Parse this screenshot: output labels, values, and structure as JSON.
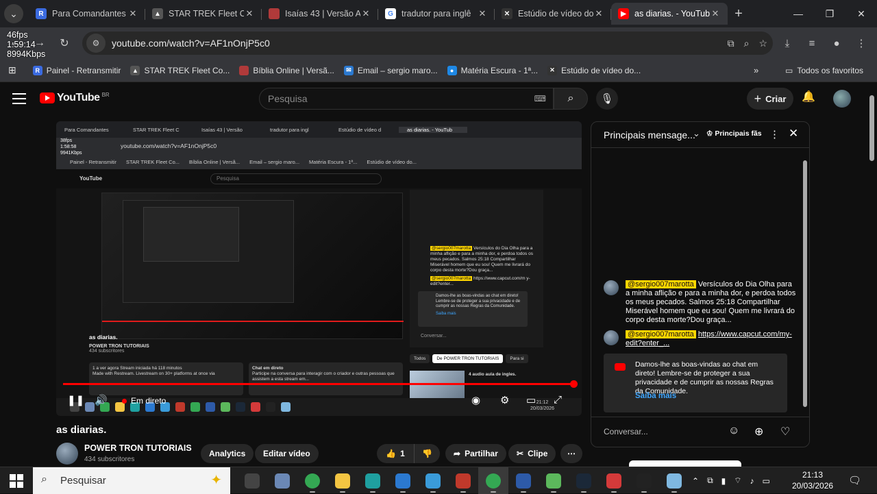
{
  "browser": {
    "tabs": [
      {
        "title": "Para Comandantes",
        "color": "#3b6be0",
        "glyph": "R"
      },
      {
        "title": "STAR TREK Fleet Co",
        "color": "#555555",
        "glyph": "▲"
      },
      {
        "title": "Isaías 43 | Versão A",
        "color": "#b03a3a",
        "glyph": ""
      },
      {
        "title": "tradutor para inglê",
        "color": "#ffffff",
        "glyph": "G"
      },
      {
        "title": "Estúdio de vídeo do",
        "color": "#333333",
        "glyph": "✕"
      },
      {
        "title": "as diarias. - YouTub",
        "color": "#ff0000",
        "glyph": "▶"
      }
    ],
    "url": "youtube.com/watch?v=AF1nOnjP5c0",
    "stats": [
      "46fps",
      "1:59:14",
      "8994Kbps"
    ],
    "bookmarks": [
      {
        "label": "Painel - Retransmitir",
        "color": "#3b6be0",
        "glyph": "R"
      },
      {
        "label": "STAR TREK Fleet Co...",
        "color": "#555555",
        "glyph": "▲"
      },
      {
        "label": "Bíblia Online | Versã...",
        "color": "#b03a3a",
        "glyph": ""
      },
      {
        "label": "Email – sergio maro...",
        "color": "#2b79d0",
        "glyph": "✉"
      },
      {
        "label": "Matéria Escura - 1ª...",
        "color": "#1e88e5",
        "glyph": "●"
      },
      {
        "label": "Estúdio de vídeo do...",
        "color": "#333333",
        "glyph": "✕"
      }
    ],
    "all_favorites": "Todos os favoritos"
  },
  "youtube": {
    "logo": "YouTube",
    "country": "BR",
    "search_placeholder": "Pesquisa",
    "create_label": "Criar",
    "video_title": "as diarias.",
    "channel_name": "POWER TRON TUTORIAIS",
    "subscribers": "434 subscritores",
    "analytics_label": "Analytics",
    "edit_label": "Editar vídeo",
    "likes": "1",
    "share_label": "Partilhar",
    "clip_label": "Clipe",
    "live_label": "Em direto"
  },
  "inner": {
    "tabs": [
      "Para Comandantes",
      "STAR TREK Fleet C",
      "Isaías 43 | Versão",
      "tradutor para ingl",
      "Estúdio de vídeo d",
      "as diarias. - YouTub"
    ],
    "stats": [
      "38fps",
      "1:58:58",
      "9941Kbps"
    ],
    "url": "youtube.com/watch?v=AF1nOnjP5c0",
    "bookmarks": [
      "Painel - Retransmitir",
      "STAR TREK Fleet Co...",
      "Bíblia Online | Versã...",
      "Email – sergio maro...",
      "Matéria Escura - 1ª...",
      "Estúdio de vídeo do..."
    ],
    "search": "Pesquisa",
    "video_title": "as diarias.",
    "channel": "POWER TRON TUTORIAIS",
    "subs": "434 subscritores",
    "desc": [
      "1 a ver agora  Stream iniciada há 118 minutos",
      "Made with Restream. Livestream on 30+ platforms at once via"
    ],
    "chat_title": "Chat em direto",
    "chat_desc": "Participe na conversa para interagir com o criador e outras pessoas que assistem a esta stream em...",
    "chips": [
      "Todos",
      "De POWER TRON TUTORIAIS",
      "Para si"
    ],
    "rec_title": "4 audio aula  de ingles.",
    "conversar": "Conversar...",
    "date": "20/03/2026",
    "time": "21:12",
    "welcome": "Damos-lhe as boas-vindas ao chat em direto! Lembre-se de proteger a sua privacidade e de cumprir as nossas Regras da Comunidade.",
    "saiba": "Saiba mais",
    "msg1_user": "@sergio007marotta",
    "msg1_text": "Versículos do Dia Olha para a minha aflição e para a minha dor, e perdoa todos os meus pecados. Salmos 25:18 Compartilhar Miserável homem que eu sou! Quem me livrará do corpo desta morte?Dou graça...",
    "msg2_user": "@sergio007marotta",
    "msg2_link": "https://www.capcut.com/m y-edit?enter..."
  },
  "chat": {
    "title": "Principais mensage...",
    "top_fans": "Principais fãs",
    "messages": [
      {
        "user": "@sergio007marotta",
        "text": "Versículos do Dia Olha para a minha aflição e para a minha dor, e perdoa todos os meus pecados. Salmos 25:18 Compartilhar Miserável homem que eu sou! Quem me livrará do corpo desta morte?Dou graça..."
      },
      {
        "user": "@sergio007marotta",
        "link": "https://www.capcut.com/my-edit?enter_..."
      }
    ],
    "welcome": "Damos-lhe as boas-vindas ao chat em direto! Lembre-se de proteger a sua privacidade e de cumprir as nossas Regras da Comunidade.",
    "learn_more": "Saiba mais",
    "input_placeholder": "Conversar..."
  },
  "taskbar": {
    "search_placeholder": "Pesquisar",
    "time": "21:13",
    "date": "20/03/2026",
    "apps": [
      {
        "name": "task-view",
        "color": "#444444"
      },
      {
        "name": "files",
        "color": "#6b88b5"
      },
      {
        "name": "chrome",
        "color": "#34a853"
      },
      {
        "name": "file-explorer",
        "color": "#f4c542"
      },
      {
        "name": "edge",
        "color": "#1fa0a0"
      },
      {
        "name": "mail",
        "color": "#2b79d0"
      },
      {
        "name": "photos",
        "color": "#3a9bd9"
      },
      {
        "name": "camera-app",
        "color": "#c0392b"
      },
      {
        "name": "chrome-active",
        "color": "#34a853"
      },
      {
        "name": "powershell",
        "color": "#2d5aa8"
      },
      {
        "name": "torrent",
        "color": "#5cb85c"
      },
      {
        "name": "steam",
        "color": "#1b2838"
      },
      {
        "name": "racing-game",
        "color": "#d43a3a"
      },
      {
        "name": "capcut",
        "color": "#222222"
      },
      {
        "name": "notes",
        "color": "#7fb8e0"
      }
    ]
  }
}
